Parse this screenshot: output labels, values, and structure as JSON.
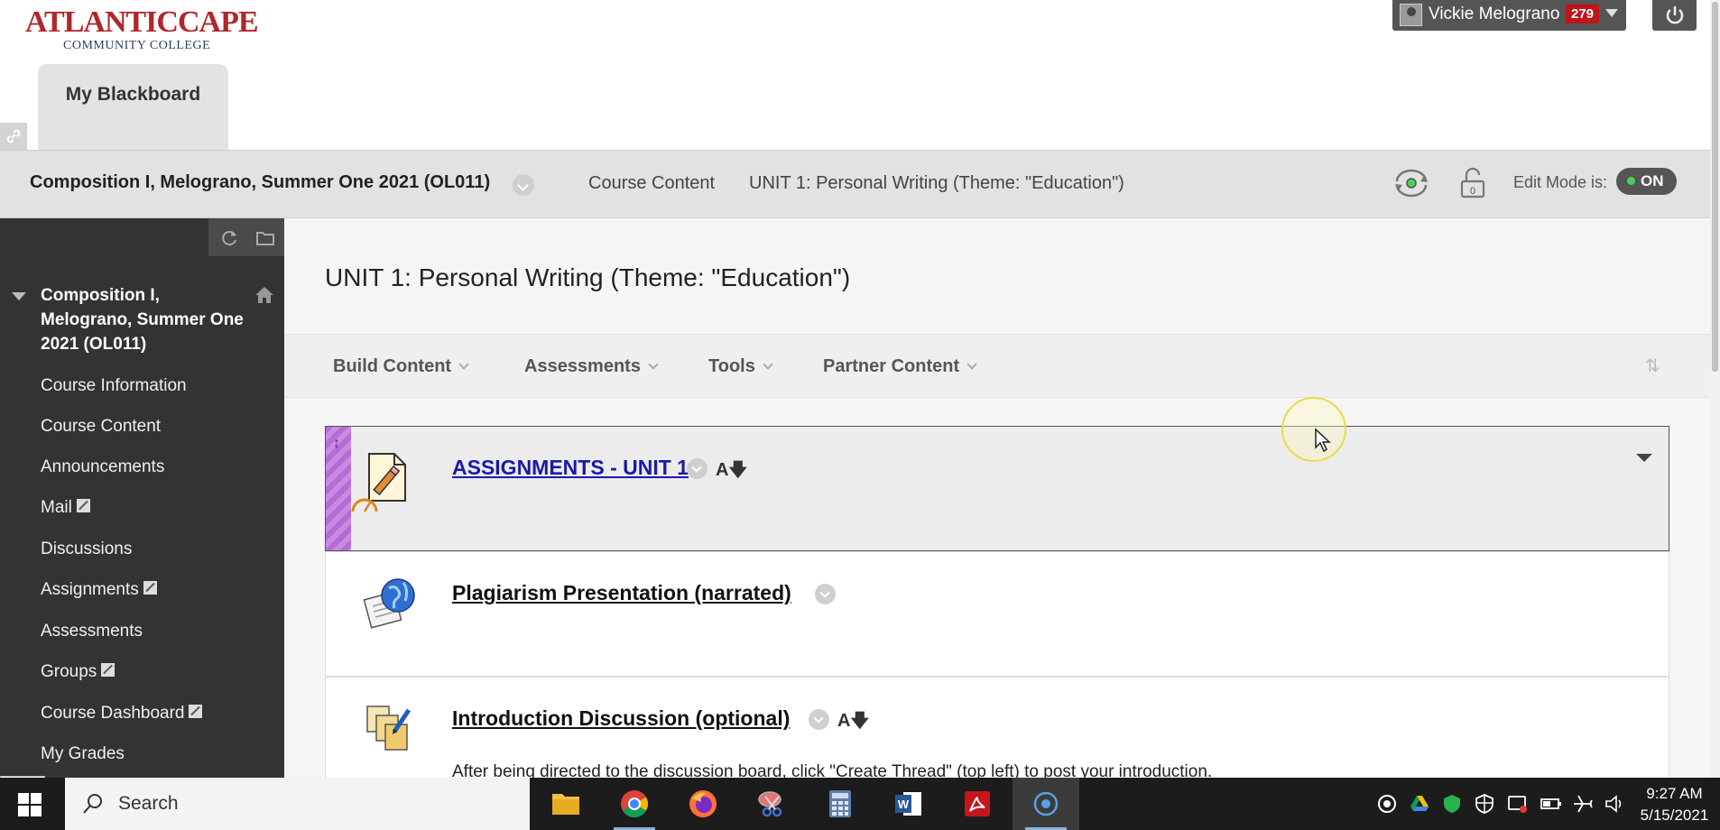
{
  "header": {
    "logo_text": "ATLANTICCAPE",
    "logo_sub": "COMMUNITY COLLEGE",
    "tab_label": "My Blackboard",
    "user_name": "Vickie Melograno",
    "notification_count": "279"
  },
  "course_bar": {
    "course_title": "Composition I, Melograno, Summer One 2021 (OL011)",
    "crumbs": [
      "Course Content",
      "UNIT 1: Personal Writing (Theme: \"Education\")"
    ],
    "edit_mode_label": "Edit Mode is:",
    "edit_mode_state": "ON",
    "lock_count": "0"
  },
  "sidebar": {
    "course_home": "Composition I, Melograno, Summer One 2021 (OL011)",
    "items": [
      {
        "label": "Course Information",
        "hidden": false
      },
      {
        "label": "Course Content",
        "hidden": false
      },
      {
        "label": "Announcements",
        "hidden": false
      },
      {
        "label": "Mail",
        "hidden": true
      },
      {
        "label": "Discussions",
        "hidden": false
      },
      {
        "label": "Assignments",
        "hidden": true
      },
      {
        "label": "Assessments",
        "hidden": false
      },
      {
        "label": "Groups",
        "hidden": true
      },
      {
        "label": "Course Dashboard",
        "hidden": true
      },
      {
        "label": "My Grades",
        "hidden": false
      }
    ]
  },
  "main": {
    "page_title": "UNIT 1: Personal Writing (Theme: \"Education\")",
    "actions": [
      "Build Content",
      "Assessments",
      "Tools",
      "Partner Content"
    ],
    "content_items": [
      {
        "title": "ASSIGNMENTS - UNIT 1",
        "description": ""
      },
      {
        "title": "Plagiarism Presentation (narrated)",
        "description": ""
      },
      {
        "title": "Introduction Discussion (optional)",
        "description": "After being directed to the discussion board, click \"Create Thread\" (top left) to post your introduction."
      }
    ]
  },
  "taskbar": {
    "search_placeholder": "Search",
    "time": "9:27 AM",
    "date": "5/15/2021"
  },
  "colors": {
    "brand_red": "#b0262b",
    "sidebar_bg": "#333333",
    "edit_on": "#4bd05a",
    "adaptive_release": "#b76bd6"
  }
}
